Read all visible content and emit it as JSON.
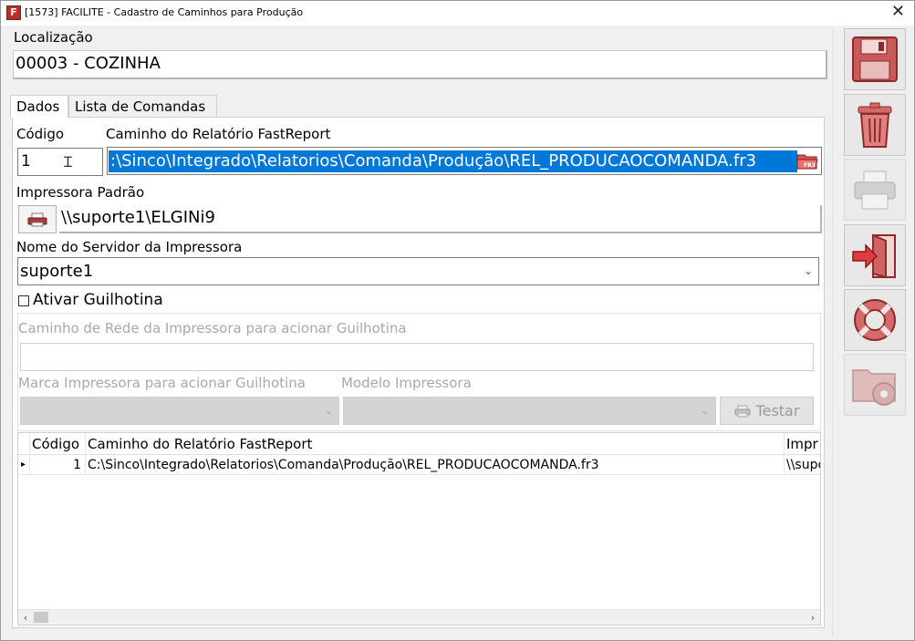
{
  "window": {
    "title": "[1573] FACILITE - Cadastro de Caminhos para Produção",
    "app_icon_letter": "F",
    "close_glyph": "✕"
  },
  "localizacao": {
    "label": "Localização",
    "value": "00003 - COZINHA"
  },
  "tabs": [
    {
      "label": "Dados",
      "active": true
    },
    {
      "label": "Lista de Comandas",
      "active": false
    }
  ],
  "form": {
    "codigo_label": "Código",
    "codigo_value": "1",
    "caminho_label": "Caminho do Relatório FastReport",
    "caminho_value": ":\\Sinco\\Integrado\\Relatorios\\Comanda\\Produção\\REL_PRODUCAOCOMANDA.fr3",
    "folder_icon_text": "FR3",
    "impressora_label": "Impressora Padrão",
    "impressora_value": "\\\\suporte1\\ELGINi9",
    "servidor_label": "Nome do Servidor da Impressora",
    "servidor_value": "suporte1",
    "guilhotina_label": "Ativar Guilhotina",
    "guilhotina_checked": false,
    "rede_label": "Caminho de Rede da Impressora para acionar Guilhotina",
    "rede_value": "",
    "marca_label": "Marca Impressora para acionar Guilhotina",
    "modelo_label": "Modelo Impressora",
    "testar_label": "Testar"
  },
  "grid": {
    "columns": [
      "Código",
      "Caminho do Relatório FastReport",
      "Impr"
    ],
    "rows": [
      {
        "codigo": "1",
        "caminho": "C:\\Sinco\\Integrado\\Relatorios\\Comanda\\Produção\\REL_PRODUCAOCOMANDA.fr3",
        "impressora": "\\\\supo"
      }
    ],
    "row_indicator": "▸"
  },
  "sidebar": {
    "buttons": [
      {
        "name": "save",
        "icon": "floppy-disk-icon",
        "enabled": true
      },
      {
        "name": "delete",
        "icon": "trash-icon",
        "enabled": true
      },
      {
        "name": "print",
        "icon": "printer-icon",
        "enabled": false
      },
      {
        "name": "exit",
        "icon": "exit-door-icon",
        "enabled": true
      },
      {
        "name": "help",
        "icon": "lifebuoy-icon",
        "enabled": true
      },
      {
        "name": "settings",
        "icon": "folder-gear-icon",
        "enabled": false
      }
    ]
  },
  "colors": {
    "selection": "#0078d7",
    "accent_red": "#c94f4f"
  }
}
